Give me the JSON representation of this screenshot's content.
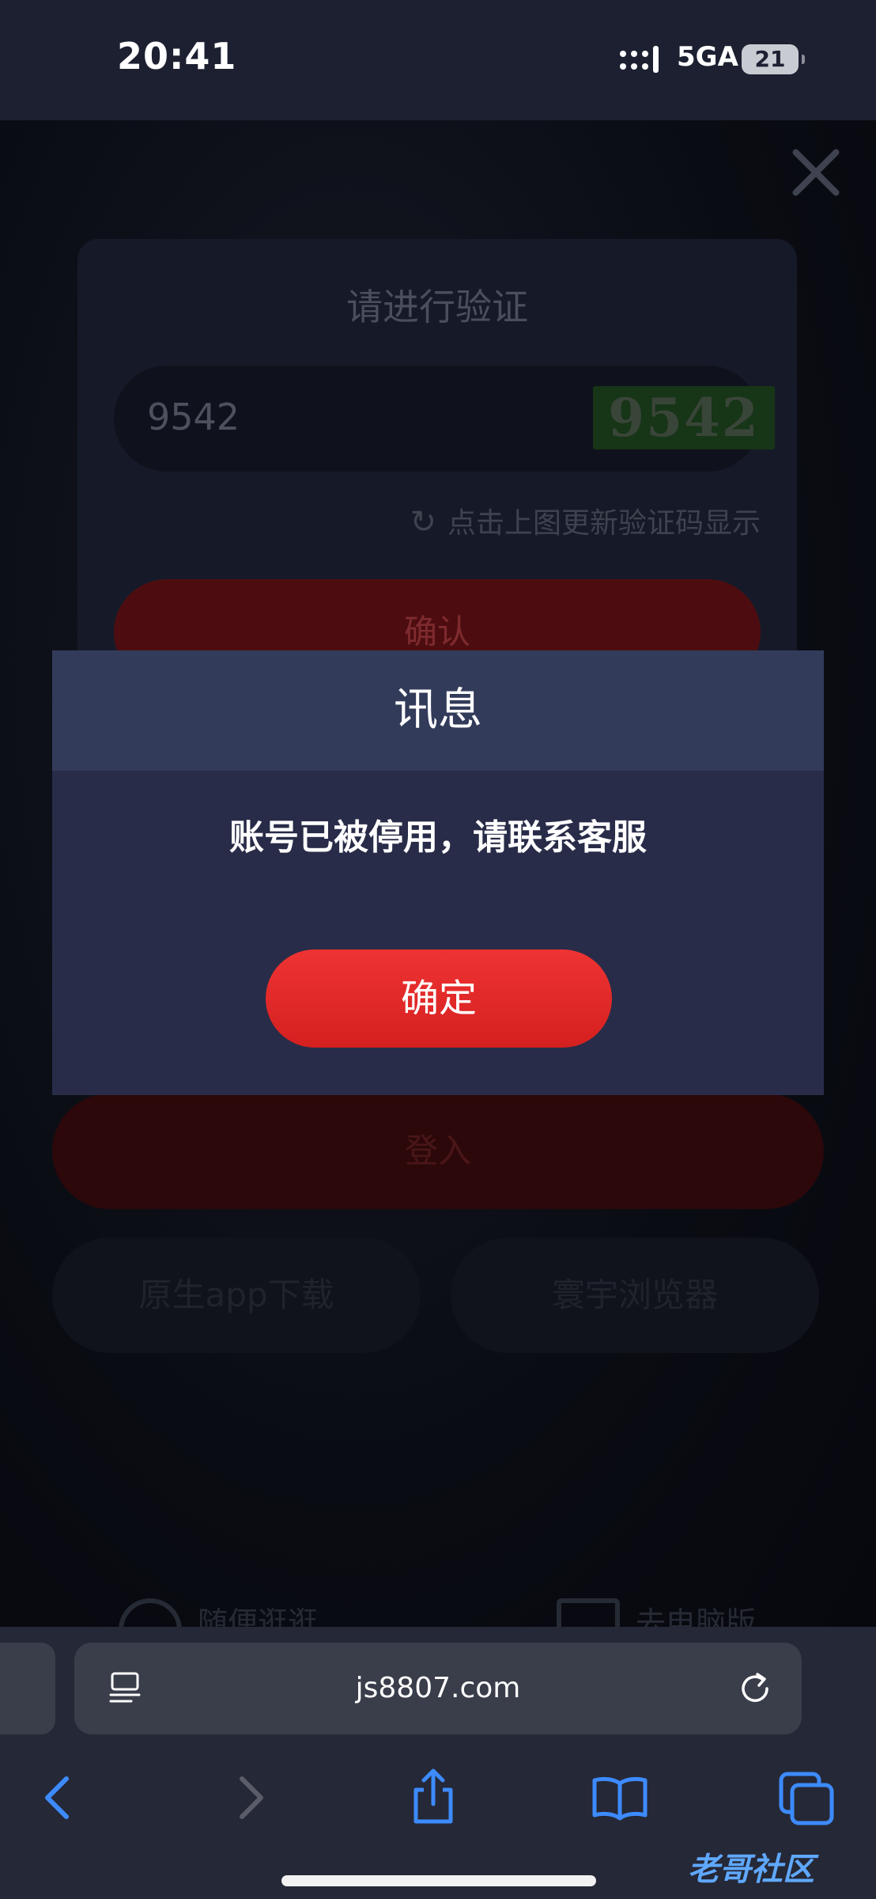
{
  "status_bar": {
    "time": "20:41",
    "network": "5GA",
    "battery": "21"
  },
  "verify": {
    "title": "请进行验证",
    "code_value": "9542",
    "captcha_text": "9542",
    "refresh_hint": "点击上图更新验证码显示",
    "confirm_label": "确认"
  },
  "login": {
    "label": "登入"
  },
  "actions": {
    "app_download": "原生app下载",
    "browser": "寰宇浏览器"
  },
  "footer": {
    "left": "随便逛逛",
    "right": "去电脑版"
  },
  "dialog": {
    "title": "讯息",
    "message": "账号已被停用，请联系客服",
    "ok_label": "确定"
  },
  "browser_bar": {
    "url": "js8807.com"
  },
  "watermark": "老哥社区"
}
